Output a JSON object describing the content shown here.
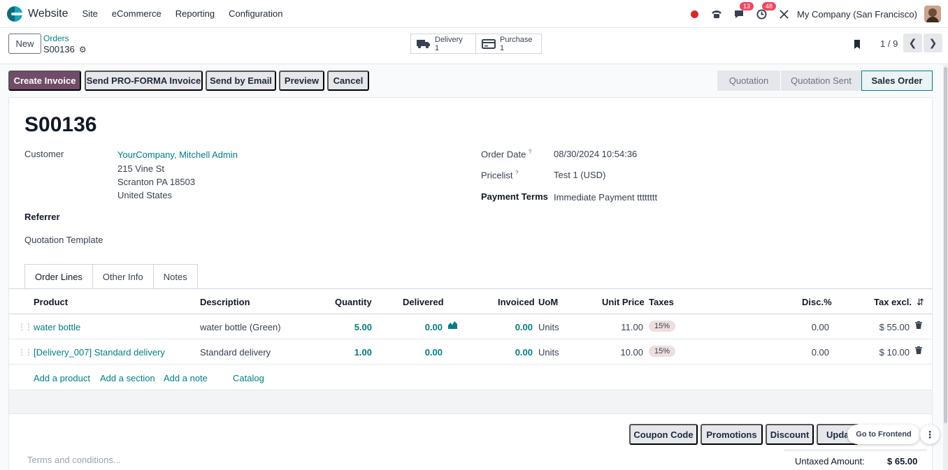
{
  "navbar": {
    "app_name": "Website",
    "menu": [
      "Site",
      "eCommerce",
      "Reporting",
      "Configuration"
    ],
    "messages_count": "13",
    "activities_count": "48",
    "company": "My Company (San Francisco)"
  },
  "control_panel": {
    "new_label": "New",
    "breadcrumb_parent": "Orders",
    "breadcrumb_current": "S00136",
    "smart_buttons": [
      {
        "label": "Delivery",
        "count": "1",
        "icon": "truck-icon"
      },
      {
        "label": "Purchase",
        "count": "1",
        "icon": "credit-card-icon"
      }
    ],
    "pager": "1 / 9"
  },
  "actions": {
    "create_invoice": "Create Invoice",
    "send_proforma": "Send PRO-FORMA Invoice",
    "send_email": "Send by Email",
    "preview": "Preview",
    "cancel": "Cancel"
  },
  "stages": [
    "Quotation",
    "Quotation Sent",
    "Sales Order"
  ],
  "form": {
    "title": "S00136",
    "customer_label": "Customer",
    "customer_name": "YourCompany, Mitchell Admin",
    "address": [
      "215 Vine St",
      "Scranton PA 18503",
      "United States"
    ],
    "referrer_label": "Referrer",
    "quotation_template_label": "Quotation Template",
    "order_date_label": "Order Date",
    "order_date": "08/30/2024 10:54:36",
    "pricelist_label": "Pricelist",
    "pricelist": "Test 1 (USD)",
    "payment_terms_label": "Payment Terms",
    "payment_terms": "Immediate Payment tttttttt",
    "help_mark": "?"
  },
  "tabs": [
    "Order Lines",
    "Other Info",
    "Notes"
  ],
  "table": {
    "columns": [
      "Product",
      "Description",
      "Quantity",
      "Delivered",
      "Invoiced",
      "UoM",
      "Unit Price",
      "Taxes",
      "Disc.%",
      "Tax excl."
    ],
    "rows": [
      {
        "product": "water bottle",
        "description": "water bottle (Green)",
        "quantity": "5.00",
        "delivered": "0.00",
        "invoiced": "0.00",
        "uom": "Units",
        "unit_price": "11.00",
        "taxes": "15%",
        "discount": "0.00",
        "subtotal": "$ 55.00"
      },
      {
        "product": "[Delivery_007] Standard delivery",
        "description": "Standard delivery",
        "quantity": "1.00",
        "delivered": "0.00",
        "invoiced": "0.00",
        "uom": "Units",
        "unit_price": "10.00",
        "taxes": "15%",
        "discount": "0.00",
        "subtotal": "$ 10.00"
      }
    ],
    "add_product": "Add a product",
    "add_section": "Add a section",
    "add_note": "Add a note",
    "catalog": "Catalog"
  },
  "footer": {
    "coupon_code": "Coupon Code",
    "promotions": "Promotions",
    "discount": "Discount",
    "update_truncated": "Updat",
    "terms_placeholder": "Terms and conditions...",
    "untaxed_label": "Untaxed Amount:",
    "untaxed_value": "$ 65.00",
    "go_to_frontend": "Go to Frontend"
  },
  "colors": {
    "primary": "#714b67",
    "link": "#017e84",
    "badge": "#ec4961"
  }
}
